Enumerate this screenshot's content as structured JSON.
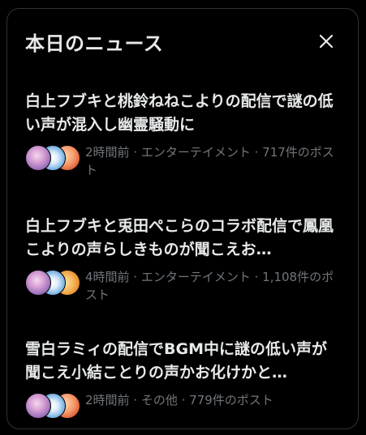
{
  "panel": {
    "title": "本日のニュース",
    "close_label": "close"
  },
  "news": [
    {
      "headline": "白上フブキと桃鈴ねねこよりの配信で謎の低い声が混入し幽霊騒動に",
      "meta": "2時間前 · エンターテイメント · 717件のポスト"
    },
    {
      "headline": "白上フブキと兎田ぺこらのコラボ配信で鳳凰こよりの声らしきものが聞こえお…",
      "meta": "4時間前 · エンターテイメント · 1,108件のポスト"
    },
    {
      "headline": "雪白ラミィの配信でBGM中に謎の低い声が聞こえ小結ことりの声かお化けかと…",
      "meta": "2時間前 · その他 · 779件のポスト"
    }
  ],
  "colors": {
    "background": "#000000",
    "border": "#2f3336",
    "text_primary": "#e7e9ea",
    "text_secondary": "#71767b"
  }
}
